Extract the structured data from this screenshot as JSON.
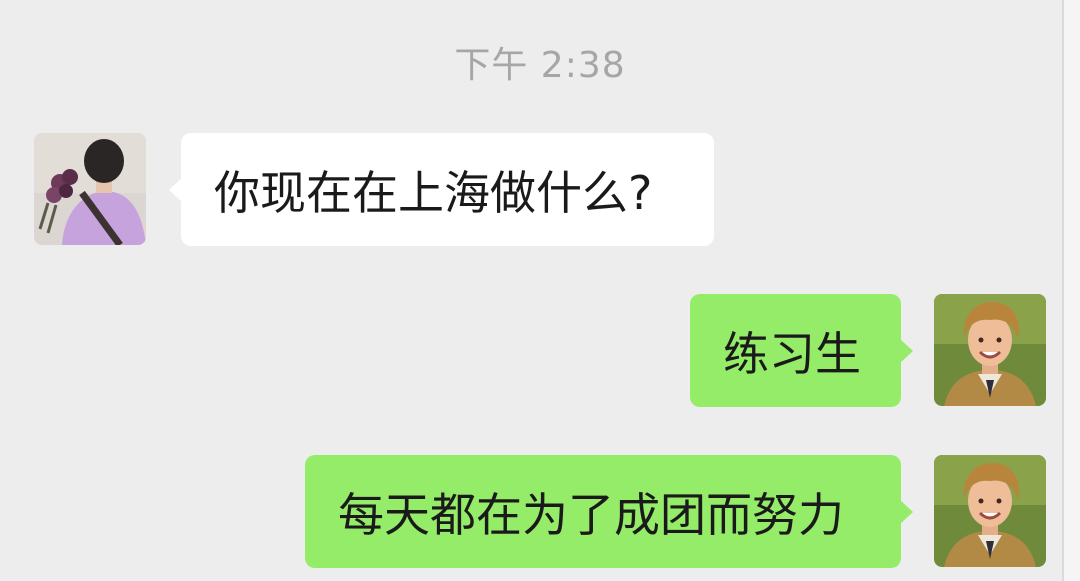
{
  "chat": {
    "timestamp": "下午 2:38",
    "messages": [
      {
        "sender": "other",
        "avatar_icon": "user-avatar-purple-shirt",
        "text": "你现在在上海做什么?"
      },
      {
        "sender": "self",
        "avatar_icon": "user-avatar-boy-smiling",
        "text": "练习生"
      },
      {
        "sender": "self",
        "avatar_icon": "user-avatar-boy-smiling",
        "text": "每天都在为了成团而努力"
      }
    ]
  },
  "colors": {
    "background": "#ededed",
    "bubble_incoming": "#ffffff",
    "bubble_outgoing": "#95ec69",
    "timestamp_text": "#a6a6a6"
  }
}
